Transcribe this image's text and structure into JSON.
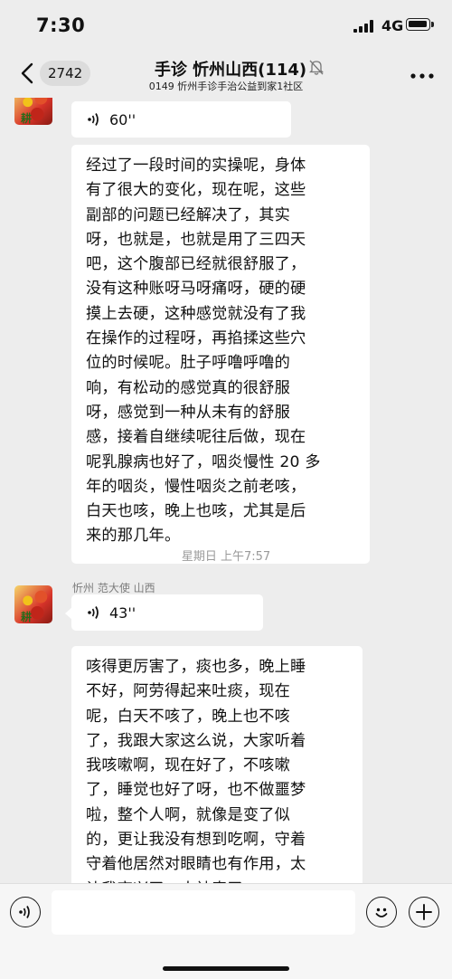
{
  "status_bar": {
    "time": "7:30",
    "network": "4G"
  },
  "nav": {
    "unread_count": "2742",
    "title": "手诊 忻州山西(114)",
    "subtitle": "0149 忻州手诊手治公益到家1社区"
  },
  "messages": {
    "voice1_duration": "60''",
    "text1": "经过了一段时间的实操呢，身体\n有了很大的变化，现在呢，这些\n副部的问题已经解决了，其实\n呀，也就是，也就是用了三四天\n吧，这个腹部已经就很舒服了，\n没有这种账呀马呀痛呀，硬的硬\n摸上去硬，这种感觉就没有了我\n在操作的过程呀，再掐揉这些穴\n位的时候呢。肚子呼噜呼噜的\n响，有松动的感觉真的很舒服\n呀，感觉到一种从未有的舒服\n感，接着自继续呢往后做，现在\n呢乳腺病也好了，咽炎慢性 20 多\n年的咽炎，慢性咽炎之前老咳，\n白天也咳，晚上也咳，尤其是后\n来的那几年。",
    "timestamp": "星期日 上午7:57",
    "sender_name": "忻州 范大使 山西",
    "voice2_duration": "43''",
    "text2": "咳得更厉害了，痰也多，晚上睡\n不好，阿劳得起来吐痰，现在\n呢，白天不咳了，晚上也不咳\n了，我跟大家这么说，大家听着\n我咳嗽啊，现在好了，不咳嗽\n了，睡觉也好了呀，也不做噩梦\n啦，整个人啊，就像是变了似\n的，更让我没有想到吃啊，守着\n守着他居然对眼睛也有作用，太\n让我高兴了，太神奇了。"
  },
  "colors": {
    "background": "#ededed",
    "bubble": "#ffffff",
    "muted_text": "#9a9a9a"
  },
  "icons": {
    "back": "chevron-left-icon",
    "mute": "bell-off-icon",
    "more": "more-icon",
    "voice": "voice-wave-icon",
    "voice_mode": "voice-mode-icon",
    "emoji": "emoji-icon",
    "add": "add-icon"
  }
}
